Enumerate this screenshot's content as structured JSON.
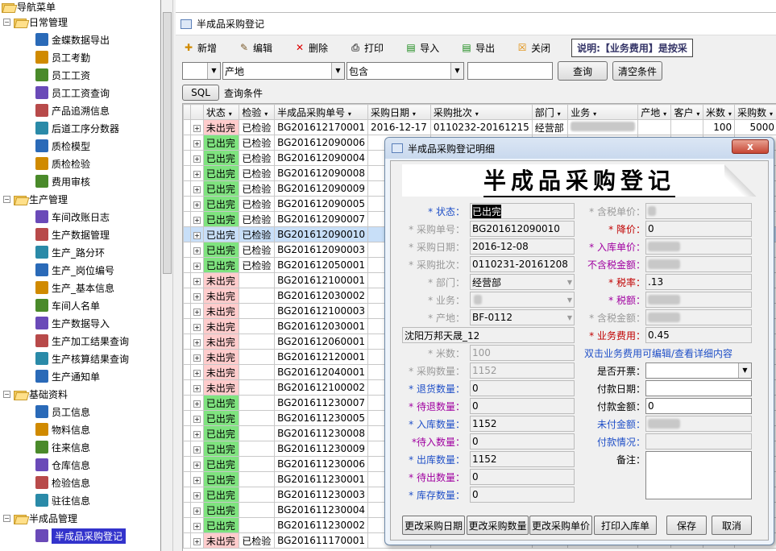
{
  "nav": {
    "title": "导航菜单",
    "groups": [
      {
        "label": "日常管理",
        "items": [
          "金蝶数据导出",
          "员工考勤",
          "员工工资",
          "员工工资查询",
          "产品追溯信息",
          "后道工序分数器",
          "质检模型",
          "质检检验",
          "费用审核"
        ]
      },
      {
        "label": "生产管理",
        "items": [
          "车间改账日志",
          "生产数据管理",
          "生产_路分环",
          "生产_岗位编号",
          "生产_基本信息",
          "车间人名单",
          "生产数据导入",
          "生产加工结果查询",
          "生产核算结果查询",
          "生产通知单"
        ]
      },
      {
        "label": "基础资料",
        "items": [
          "员工信息",
          "物料信息",
          "往来信息",
          "仓库信息",
          "检验信息",
          "驻往信息"
        ]
      },
      {
        "label": "半成品管理",
        "items": [
          "半成品采购登记"
        ]
      }
    ]
  },
  "window": {
    "title": "半成品采购登记"
  },
  "toolbar": {
    "new": "新增",
    "edit": "编辑",
    "delete": "删除",
    "print": "打印",
    "import": "导入",
    "export": "导出",
    "close": "关闭",
    "note": "说明:【业务费用】是按采"
  },
  "filter": {
    "field": "产地",
    "op": "包含",
    "value": "",
    "query": "查询",
    "clear": "清空条件"
  },
  "sql": {
    "btn": "SQL",
    "label": "查询条件"
  },
  "grid": {
    "headers": [
      "状态",
      "检验",
      "半成品采购单号",
      "采购日期",
      "采购批次",
      "部门",
      "业务",
      "产地",
      "客户",
      "米数",
      "采购数"
    ],
    "first": {
      "status": "未出完",
      "check": "已检验",
      "no": "BG201612170001",
      "date": "2016-12-17",
      "batch": "0110232-20161215",
      "dept": "经营部",
      "meters": "100",
      "qty": "5000"
    },
    "rows": [
      {
        "status": "已出完",
        "check": "已检验",
        "no": "BG201612090006",
        "kind": "g"
      },
      {
        "status": "已出完",
        "check": "已检验",
        "no": "BG201612090004",
        "kind": "g"
      },
      {
        "status": "已出完",
        "check": "已检验",
        "no": "BG201612090008",
        "kind": "g"
      },
      {
        "status": "已出完",
        "check": "已检验",
        "no": "BG201612090009",
        "kind": "g"
      },
      {
        "status": "已出完",
        "check": "已检验",
        "no": "BG201612090005",
        "kind": "g"
      },
      {
        "status": "已出完",
        "check": "已检验",
        "no": "BG201612090007",
        "kind": "g"
      },
      {
        "status": "已出完",
        "check": "已检验",
        "no": "BG201612090010",
        "kind": "g",
        "sel": true
      },
      {
        "status": "已出完",
        "check": "已检验",
        "no": "BG201612090003",
        "kind": "g"
      },
      {
        "status": "已出完",
        "check": "已检验",
        "no": "BG201612050001",
        "kind": "g"
      },
      {
        "status": "未出完",
        "check": "",
        "no": "BG201612100001",
        "kind": "r"
      },
      {
        "status": "未出完",
        "check": "",
        "no": "BG201612030002",
        "kind": "r"
      },
      {
        "status": "未出完",
        "check": "",
        "no": "BG201612100003",
        "kind": "r"
      },
      {
        "status": "未出完",
        "check": "",
        "no": "BG201612030001",
        "kind": "r"
      },
      {
        "status": "未出完",
        "check": "",
        "no": "BG201612060001",
        "kind": "r"
      },
      {
        "status": "未出完",
        "check": "",
        "no": "BG201612120001",
        "kind": "r"
      },
      {
        "status": "未出完",
        "check": "",
        "no": "BG201612040001",
        "kind": "r"
      },
      {
        "status": "未出完",
        "check": "",
        "no": "BG201612100002",
        "kind": "r"
      },
      {
        "status": "已出完",
        "check": "",
        "no": "BG201611230007",
        "kind": "g"
      },
      {
        "status": "已出完",
        "check": "",
        "no": "BG201611230005",
        "kind": "g"
      },
      {
        "status": "已出完",
        "check": "",
        "no": "BG201611230008",
        "kind": "g"
      },
      {
        "status": "已出完",
        "check": "",
        "no": "BG201611230009",
        "kind": "g"
      },
      {
        "status": "已出完",
        "check": "",
        "no": "BG201611230006",
        "kind": "g"
      },
      {
        "status": "已出完",
        "check": "",
        "no": "BG201611230001",
        "kind": "g"
      },
      {
        "status": "已出完",
        "check": "",
        "no": "BG201611230003",
        "kind": "g"
      },
      {
        "status": "已出完",
        "check": "",
        "no": "BG201611230004",
        "kind": "g"
      },
      {
        "status": "已出完",
        "check": "",
        "no": "BG201611230002",
        "kind": "g"
      },
      {
        "status": "未出完",
        "check": "已检验",
        "no": "BG201611170001",
        "kind": "r"
      }
    ]
  },
  "dialog": {
    "title": "半成品采购登记明细",
    "banner": "半成品采购登记",
    "close": "x",
    "left": [
      {
        "label": "* 状态：",
        "value": "已出完",
        "cls": "blue"
      },
      {
        "label": "* 采购单号：",
        "value": "BG201612090010",
        "cls": "gray"
      },
      {
        "label": "* 采购日期：",
        "value": "2016-12-08",
        "cls": "gray"
      },
      {
        "label": "* 采购批次：",
        "value": "0110231-20161208",
        "cls": "gray"
      },
      {
        "label": "* 部门：",
        "value": "经营部",
        "cls": "gray"
      },
      {
        "label": "* 业务：",
        "value": "",
        "cls": "gray"
      },
      {
        "label": "* 产地：",
        "value": "BF-0112",
        "cls": "gray"
      }
    ],
    "customer": "沈阳万邦天晟_12",
    "left2": [
      {
        "label": "* 米数：",
        "value": "100",
        "cls": "gray"
      },
      {
        "label": "* 采购数量：",
        "value": "1152",
        "cls": "gray"
      },
      {
        "label": "* 退货数量：",
        "value": "0",
        "cls": "blue"
      },
      {
        "label": "* 待退数量：",
        "value": "0",
        "cls": "purple"
      },
      {
        "label": "* 入库数量：",
        "value": "1152",
        "cls": "blue"
      },
      {
        "label": "*待入数量：",
        "value": "0",
        "cls": "purple"
      },
      {
        "label": "* 出库数量：",
        "value": "1152",
        "cls": "blue"
      },
      {
        "label": "* 待出数量：",
        "value": "0",
        "cls": "purple"
      },
      {
        "label": "* 库存数量：",
        "value": "0",
        "cls": "blue"
      }
    ],
    "right": [
      {
        "label": "* 含税单价：",
        "value": "",
        "cls": "gray"
      },
      {
        "label": "* 降价：",
        "value": "0",
        "cls": "red"
      },
      {
        "label": "* 入库单价：",
        "value": "",
        "cls": "purple"
      },
      {
        "label": "不含税金额：",
        "value": "",
        "cls": "purple"
      },
      {
        "label": "* 税率：",
        "value": ".13",
        "cls": "red"
      },
      {
        "label": "* 税额：",
        "value": "",
        "cls": "purple"
      },
      {
        "label": "* 含税金额：",
        "value": "",
        "cls": "gray"
      },
      {
        "label": "* 业务费用：",
        "value": "0.45",
        "cls": "red"
      }
    ],
    "hint": "双击业务费用可编辑/查看详细内容",
    "invoice": "是否开票：",
    "paydate": "付款日期：",
    "payamt": "付款金额：",
    "payamt_val": "0",
    "unpaid": "未付金额：",
    "paystatus": "付款情况：",
    "remark": "备注：",
    "buttons": [
      "更改采购日期",
      "更改采购数量",
      "更改采购单价",
      "打印入库单",
      "保存",
      "取消"
    ]
  }
}
